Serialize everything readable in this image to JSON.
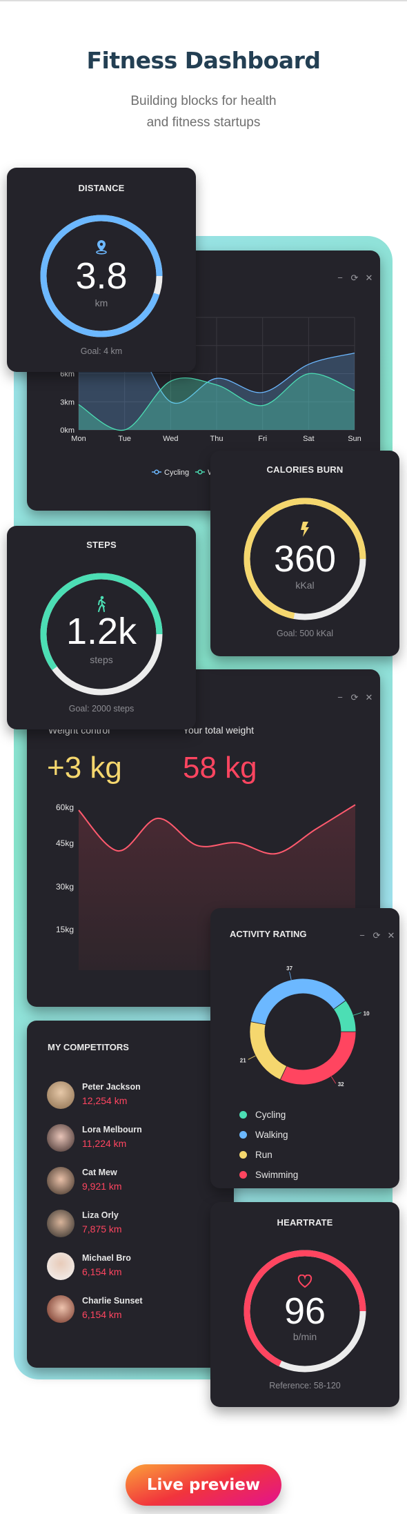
{
  "header": {
    "title": "Fitness Dashboard",
    "subtitle_line1": "Building blocks for health",
    "subtitle_line2": "and fitness startups"
  },
  "colors": {
    "card": "#24232a",
    "blue": "#6cb8ff",
    "green": "#4cdeb4",
    "yellow": "#f5d76e",
    "red": "#ff4560",
    "track": "#ececec"
  },
  "controls": {
    "minimize": "−",
    "refresh": "⟳",
    "close": "✕"
  },
  "distance": {
    "title": "DISTANCE",
    "icon": "map-pin-icon",
    "value": "3.8",
    "unit": "km",
    "goal": "Goal: 4 km",
    "progress": 0.95,
    "color": "#6cb8ff"
  },
  "calories": {
    "title": "CALORIES BURN",
    "icon": "lightning-icon",
    "value": "360",
    "unit": "kKal",
    "goal": "Goal: 500 kKal",
    "progress": 0.72,
    "color": "#f5d76e"
  },
  "steps": {
    "title": "STEPS",
    "icon": "walking-person-icon",
    "value": "1.2k",
    "unit": "steps",
    "goal": "Goal: 2000 steps",
    "progress": 0.6,
    "color": "#4cdeb4"
  },
  "heartrate": {
    "title": "HEARTRATE",
    "icon": "heart-icon",
    "value": "96",
    "unit": "b/min",
    "goal": "Reference: 58-120",
    "progress": 0.68,
    "color": "#ff4560"
  },
  "weight": {
    "label_control": "Weight control",
    "label_total": "Your total weight",
    "control_value": "+3 kg",
    "total_value": "58 kg"
  },
  "activity": {
    "title": "ACTIVITY RATING"
  },
  "competitors": {
    "title": "MY COMPETITORS",
    "items": [
      {
        "name": "Peter Jackson",
        "distance": "12,254 km"
      },
      {
        "name": "Lora Melbourn",
        "distance": "11,224 km"
      },
      {
        "name": "Cat Mew",
        "distance": "9,921 km"
      },
      {
        "name": "Liza Orly",
        "distance": "7,875 km"
      },
      {
        "name": "Michael Bro",
        "distance": "6,154 km"
      },
      {
        "name": "Charlie Sunset",
        "distance": "6,154 km"
      }
    ]
  },
  "cta": {
    "label": "Live preview"
  },
  "chart_data": [
    {
      "type": "area",
      "categories": [
        "Mon",
        "Tue",
        "Wed",
        "Thu",
        "Fri",
        "Sat",
        "Sun"
      ],
      "ytick_labels": [
        "0km",
        "3km",
        "6km"
      ],
      "yticks": [
        0,
        3,
        6,
        9,
        12
      ],
      "ylim": [
        0,
        12
      ],
      "grid": true,
      "legend": "bottom",
      "series": [
        {
          "name": "Cycling",
          "color": "#6cb8ff",
          "values": [
            9,
            11,
            3,
            5.5,
            4,
            7,
            8.2
          ]
        },
        {
          "name": "Walking",
          "color": "#4cdeb4",
          "values": [
            2.7,
            0,
            5.2,
            4.8,
            2.6,
            6,
            4.2
          ]
        }
      ]
    },
    {
      "type": "area",
      "ytick_labels": [
        "60kg",
        "45kg",
        "30kg",
        "15kg"
      ],
      "yticks": [
        60,
        45,
        30,
        15
      ],
      "ylim": [
        0,
        60
      ],
      "grid": false,
      "series": [
        {
          "color": "#ff5a6e",
          "values": [
            59,
            44,
            56,
            46,
            47,
            43,
            52,
            61
          ]
        }
      ]
    },
    {
      "type": "pie",
      "donut": true,
      "legend": "bottom",
      "slices": [
        {
          "label": "Cycling",
          "value": 10,
          "color": "#4cdeb4"
        },
        {
          "label": "Walking",
          "value": 37,
          "color": "#6cb8ff"
        },
        {
          "label": "Run",
          "value": 21,
          "color": "#f5d76e"
        },
        {
          "label": "Swimming",
          "value": 32,
          "color": "#ff4560"
        }
      ]
    }
  ]
}
